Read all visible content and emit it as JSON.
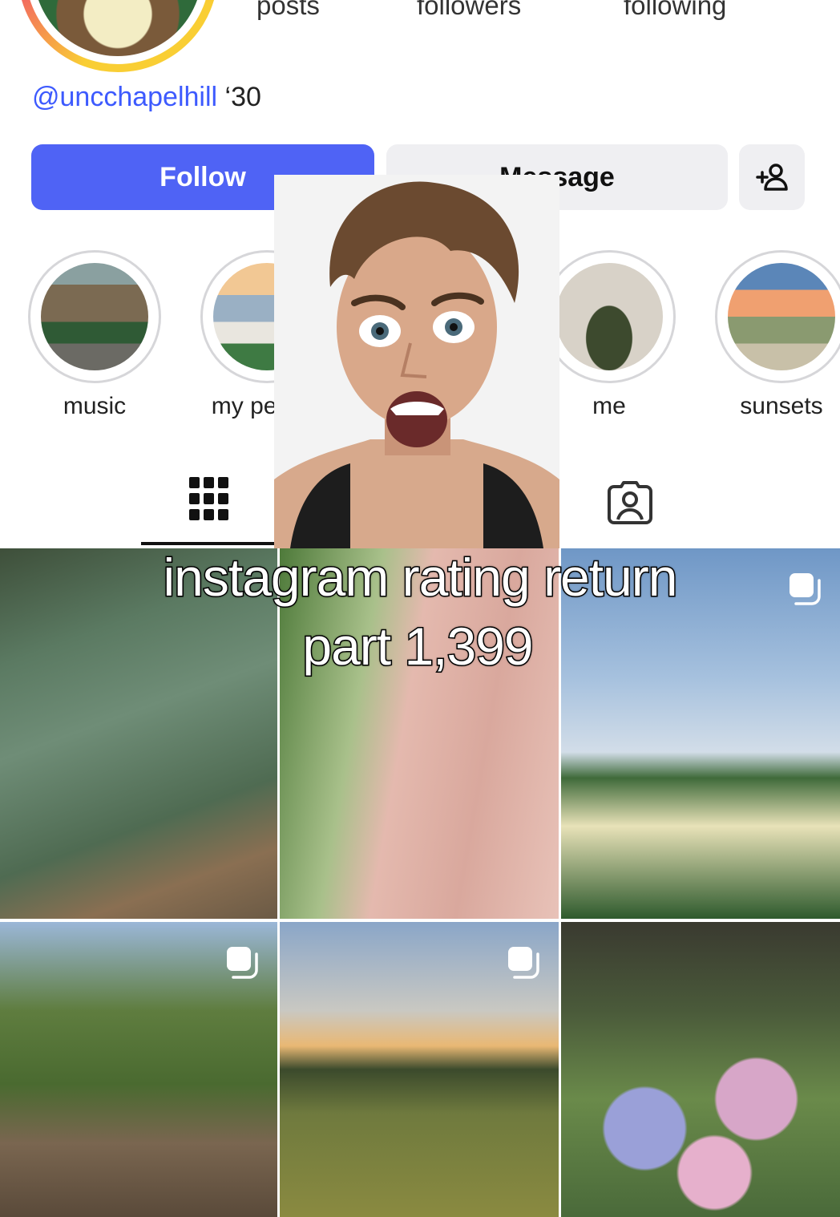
{
  "profile": {
    "stats_labels": [
      "posts",
      "followers",
      "following"
    ],
    "handle": "@uncchapelhill",
    "class_year": "‘30"
  },
  "actions": {
    "follow_label": "Follow",
    "message_label": "Message",
    "add_user_icon": "add-person-icon"
  },
  "highlights": [
    {
      "label": "music"
    },
    {
      "label": "my people"
    },
    {
      "label": "me"
    },
    {
      "label": "sunsets"
    }
  ],
  "tabs": [
    {
      "name": "posts-grid",
      "icon": "grid-icon",
      "active": true
    },
    {
      "name": "tagged",
      "icon": "tagged-person-icon",
      "active": false
    }
  ],
  "caption": {
    "line1": "instagram rating return",
    "line2": "part 1,399"
  },
  "colors": {
    "follow_button": "#4f63f5",
    "handle_link": "#3d5afe",
    "secondary_button": "#efeff2"
  }
}
